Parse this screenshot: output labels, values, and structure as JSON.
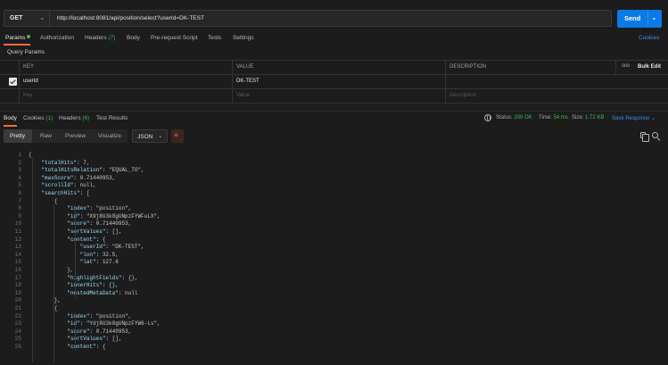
{
  "request": {
    "method": "GET",
    "url": "http://localhost:8081/api/position/select?userId=DK-TEST",
    "send_label": "Send"
  },
  "request_tabs": {
    "params": "Params",
    "authorization": "Authorization",
    "headers": "Headers",
    "headers_count": "(7)",
    "body": "Body",
    "pre_request_script": "Pre-request Script",
    "tests": "Tests",
    "settings": "Settings",
    "cookies": "Cookies"
  },
  "query_params": {
    "label": "Query Params",
    "headers": {
      "key": "KEY",
      "value": "VALUE",
      "description": "DESCRIPTION",
      "bulk_edit": "Bulk Edit",
      "more": "ooo"
    },
    "rows": [
      {
        "key": "userId",
        "value": "DK-TEST",
        "description": ""
      }
    ],
    "placeholder": {
      "key": "Key",
      "value": "Value",
      "description": "Description"
    }
  },
  "response_tabs": {
    "body": "Body",
    "cookies": "Cookies",
    "cookies_count": "(1)",
    "headers": "Headers",
    "headers_count": "(6)",
    "test_results": "Test Results"
  },
  "response_status": {
    "status_label": "Status:",
    "status_value": "200 OK",
    "time_label": "Time:",
    "time_value": "54 ms",
    "size_label": "Size:",
    "size_value": "1.72 KB",
    "save_response": "Save Response"
  },
  "view_toolbar": {
    "pretty": "Pretty",
    "raw": "Raw",
    "preview": "Preview",
    "visualize": "Visualize",
    "format": "JSON"
  },
  "code_lines": [
    {
      "n": "1",
      "t": "{"
    },
    {
      "n": "2",
      "t": "    \"totalHits\": 7,"
    },
    {
      "n": "3",
      "t": "    \"totalHitsRelation\": \"EQUAL_TO\","
    },
    {
      "n": "4",
      "t": "    \"maxScore\": 0.71440953,"
    },
    {
      "n": "5",
      "t": "    \"scrollId\": null,"
    },
    {
      "n": "6",
      "t": "    \"searchHits\": ["
    },
    {
      "n": "7",
      "t": "        {"
    },
    {
      "n": "8",
      "t": "            \"index\": \"position\","
    },
    {
      "n": "9",
      "t": "            \"id\": \"X9j8U3k8gUNpzFYWFuLX\","
    },
    {
      "n": "10",
      "t": "            \"score\": 0.71440953,"
    },
    {
      "n": "11",
      "t": "            \"sortValues\": [],"
    },
    {
      "n": "12",
      "t": "            \"content\": {"
    },
    {
      "n": "13",
      "t": "                \"userId\": \"DK-TEST\","
    },
    {
      "n": "14",
      "t": "                \"lon\": 32.5,"
    },
    {
      "n": "15",
      "t": "                \"lat\": 127.6"
    },
    {
      "n": "16",
      "t": "            },"
    },
    {
      "n": "17",
      "t": "            \"highlightFields\": {},"
    },
    {
      "n": "18",
      "t": "            \"innerHits\": {},"
    },
    {
      "n": "19",
      "t": "            \"nestedMetaData\": null"
    },
    {
      "n": "20",
      "t": "        },"
    },
    {
      "n": "21",
      "t": "        {"
    },
    {
      "n": "22",
      "t": "            \"index\": \"position\","
    },
    {
      "n": "23",
      "t": "            \"id\": \"Ydj8U3k8gUNpzFYW6-Ls\","
    },
    {
      "n": "24",
      "t": "            \"score\": 0.71440953,"
    },
    {
      "n": "25",
      "t": "            \"sortValues\": [],"
    },
    {
      "n": "26",
      "t": "            \"content\": {"
    }
  ],
  "icons": {
    "send_chevron": "chevron-down-icon",
    "method_chevron": "chevron-down-icon",
    "globe": "globe-icon",
    "wrap": "wrap-lines-icon",
    "copy": "copy-icon",
    "search": "search-icon"
  },
  "colors": {
    "accent": "#ff6c37",
    "send": "#0a7ae6",
    "status_ok": "#3fb950",
    "link": "#3a8fe8"
  }
}
